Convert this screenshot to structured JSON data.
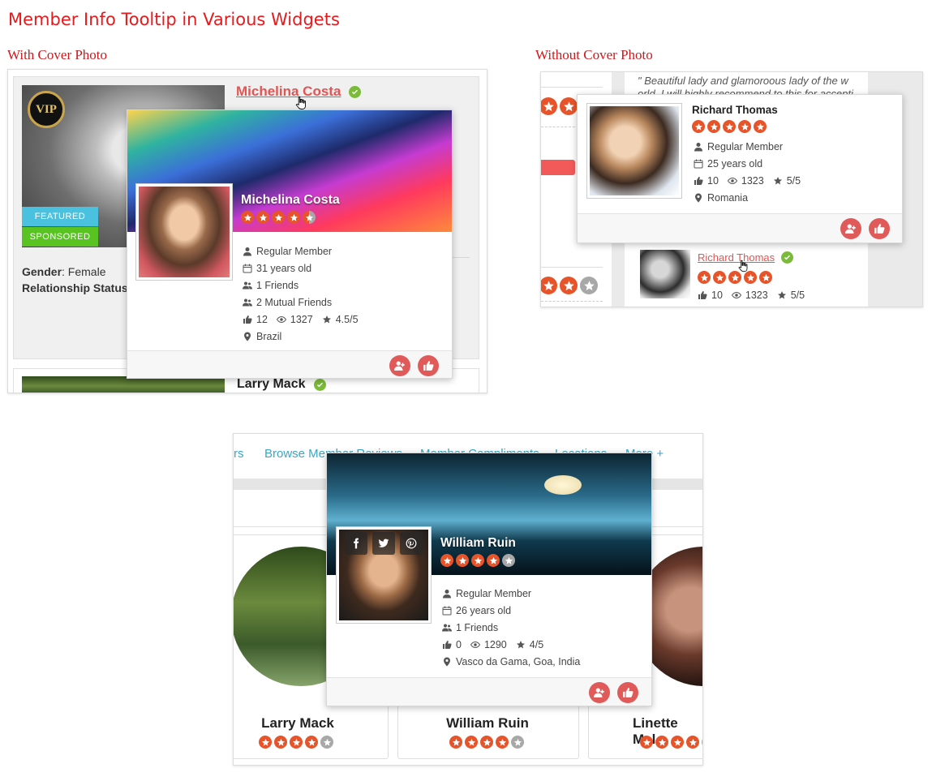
{
  "page": {
    "title": "Member Info Tooltip in Various Widgets",
    "label_with_cover": "With Cover Photo",
    "label_without_cover": "Without Cover Photo"
  },
  "colors": {
    "accent": "#e15555",
    "star": "#e8542a",
    "verified": "#7bbb3a",
    "link": "#3aa7c4",
    "title": "#e8191c"
  },
  "widget1": {
    "vip_label": "VIP",
    "badge_featured": "FEATURED",
    "badge_sponsored": "SPONSORED",
    "featured_color": "#4ac1de",
    "sponsored_color": "#58c321",
    "member_name": "Michelina Costa",
    "gender_label": "Gender",
    "gender_value": ": Female",
    "relationship_label": "Relationship Status",
    "relationship_value": ":",
    "second_member_name": "Larry Mack",
    "tooltip": {
      "name": "Michelina Costa",
      "rating": 4.5,
      "member_type": "Regular Member",
      "age": "31 years old",
      "friends": "1 Friends",
      "mutual_friends": "2 Mutual Friends",
      "likes": "12",
      "views": "1327",
      "rating_text": "4.5/5",
      "location": "Brazil"
    }
  },
  "widget2": {
    "quote": "\" Beautiful lady and glamoroous lady of the w",
    "quote_line2": "orld. I will highly recommend to this for accepti",
    "tooltip": {
      "name": "Richard Thomas",
      "rating": 5,
      "member_type": "Regular Member",
      "age": "25 years old",
      "likes": "10",
      "views": "1323",
      "rating_text": "5/5",
      "location": "Romania"
    },
    "list_member": {
      "name": "Richard Thomas",
      "rating": 5,
      "likes": "10",
      "views": "1323",
      "rating_text": "5/5"
    }
  },
  "widget3": {
    "nav": [
      "rs",
      "Browse Member Reviews",
      "Member Compliments",
      "Locations",
      "More +"
    ],
    "cards": [
      {
        "name": "Larry Mack",
        "rating": 4
      },
      {
        "name": "William Ruin",
        "rating": 4
      },
      {
        "name": "Linette Mal",
        "rating": 4
      }
    ],
    "tooltip": {
      "name": "William Ruin",
      "rating": 4,
      "member_type": "Regular Member",
      "age": "26 years old",
      "friends": "1 Friends",
      "likes": "0",
      "views": "1290",
      "rating_text": "4/5",
      "location": "Vasco da Gama, Goa, India"
    }
  }
}
